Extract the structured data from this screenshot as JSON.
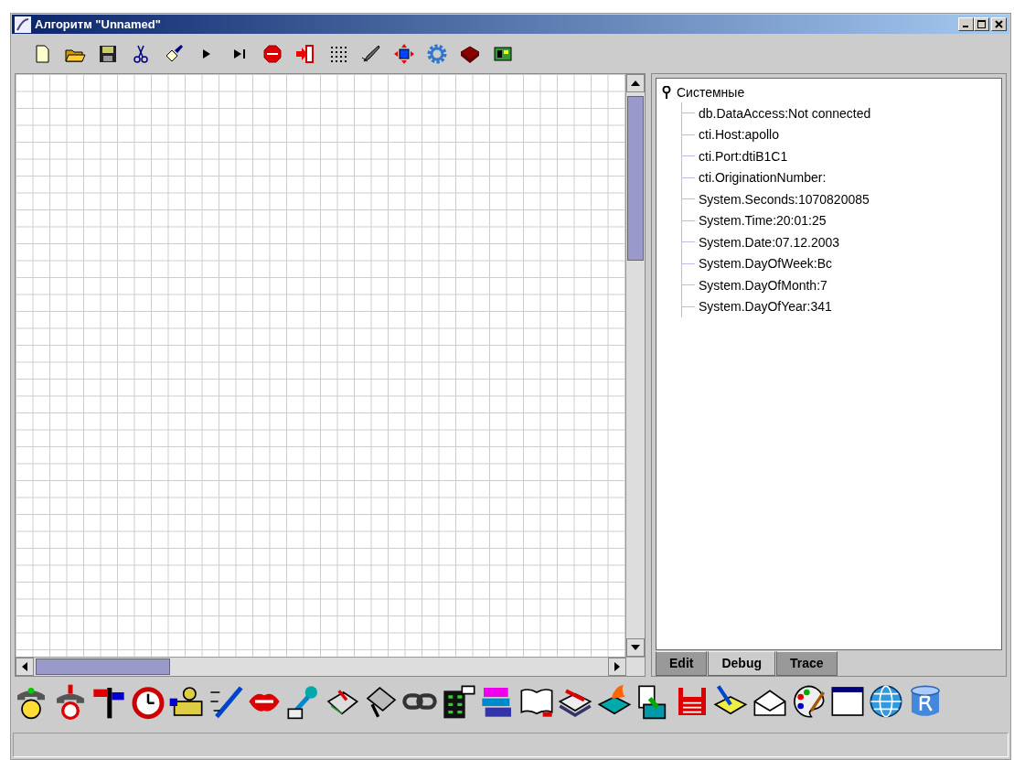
{
  "window": {
    "title": "Алгоритм \"Unnamed\""
  },
  "tree": {
    "label": "Системные",
    "expanded": true,
    "children": [
      {
        "label": "db.DataAccess:Not connected"
      },
      {
        "label": "cti.Host:apollo"
      },
      {
        "label": "cti.Port:dtiB1C1"
      },
      {
        "label": "cti.OriginationNumber:"
      },
      {
        "label": "System.Seconds:1070820085"
      },
      {
        "label": "System.Time:20:01:25"
      },
      {
        "label": "System.Date:07.12.2003"
      },
      {
        "label": "System.DayOfWeek:Вс"
      },
      {
        "label": "System.DayOfMonth:7"
      },
      {
        "label": "System.DayOfYear:341"
      }
    ]
  },
  "tabs": [
    {
      "label": "Edit",
      "selected": false
    },
    {
      "label": "Debug",
      "selected": true
    },
    {
      "label": "Trace",
      "selected": false
    }
  ]
}
